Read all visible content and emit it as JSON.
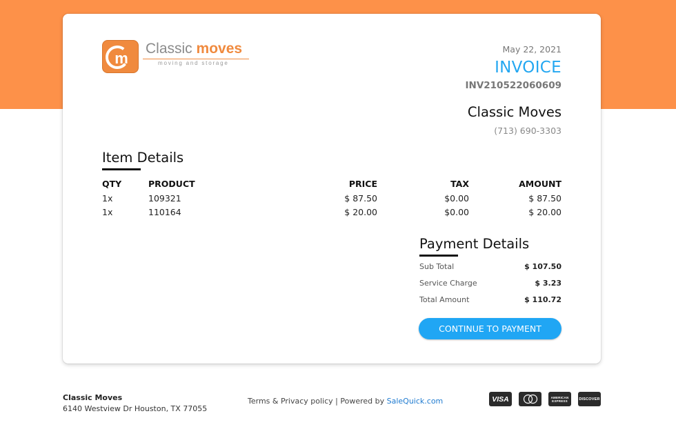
{
  "brand": {
    "logo_mark": "cm",
    "logo_word_light": "Classic ",
    "logo_word_bold": "moves",
    "logo_tagline": "moving and storage"
  },
  "invoice": {
    "date": "May 22, 2021",
    "title": "INVOICE",
    "number": "INV210522060609",
    "business_name": "Classic Moves",
    "business_phone": "(713) 690-3303"
  },
  "item_details": {
    "heading": "Item Details",
    "columns": {
      "qty": "QTY",
      "product": "PRODUCT",
      "price": "PRICE",
      "tax": "TAX",
      "amount": "AMOUNT"
    },
    "rows": [
      {
        "qty": "1x",
        "product": "109321",
        "price": "$ 87.50",
        "tax": "$0.00",
        "amount": "$ 87.50"
      },
      {
        "qty": "1x",
        "product": "110164",
        "price": "$ 20.00",
        "tax": "$0.00",
        "amount": "$ 20.00"
      }
    ]
  },
  "payment_details": {
    "heading": "Payment Details",
    "rows": [
      {
        "label": "Sub Total",
        "value": "$ 107.50"
      },
      {
        "label": "Service Charge",
        "value": "$ 3.23"
      },
      {
        "label": "Total Amount",
        "value": "$ 110.72"
      }
    ],
    "button_label": "CONTINUE TO PAYMENT"
  },
  "footer": {
    "company": "Classic Moves",
    "address": "6140 Westview Dr Houston, TX 77055",
    "terms_text": "Terms & Privacy policy | Powered by ",
    "powered_by_link": "SaleQuick.com",
    "card_logos": [
      {
        "name": "visa-icon",
        "label": "VISA"
      },
      {
        "name": "mastercard-icon",
        "label": "MasterCard"
      },
      {
        "name": "amex-icon",
        "label": "AMERICAN EXPRESS"
      },
      {
        "name": "discover-icon",
        "label": "DISCOVER"
      }
    ]
  },
  "colors": {
    "top_band": "#fd9149",
    "accent_blue": "#23a7f1",
    "brand_orange": "#f08a3e"
  }
}
